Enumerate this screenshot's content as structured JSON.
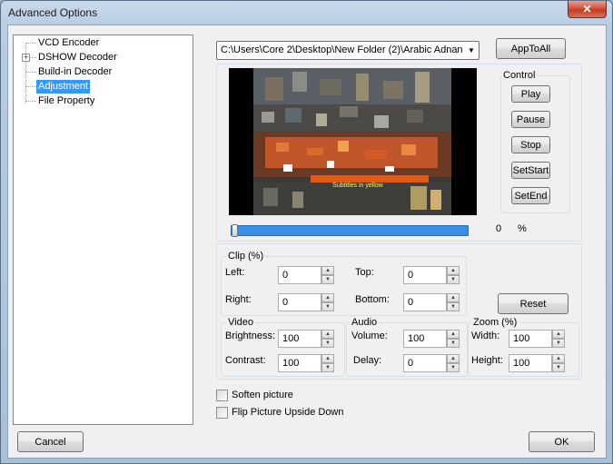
{
  "window": {
    "title": "Advanced Options",
    "close_glyph": "✕"
  },
  "tree": {
    "items": [
      {
        "label": "VCD Encoder",
        "has_children": false,
        "selected": false
      },
      {
        "label": "DSHOW Decoder",
        "has_children": true,
        "selected": false
      },
      {
        "label": "Build-in Decoder",
        "has_children": false,
        "selected": false
      },
      {
        "label": "Adjustment",
        "has_children": false,
        "selected": true
      },
      {
        "label": "File Property",
        "has_children": false,
        "selected": false
      }
    ],
    "expander_glyph": "+"
  },
  "file_combo": {
    "value": "C:\\Users\\Core 2\\Desktop\\New Folder (2)\\Arabic Adnan",
    "arrow_glyph": "▼"
  },
  "app_to_all_label": "AppToAll",
  "control": {
    "title": "Control",
    "play": "Play",
    "pause": "Pause",
    "stop": "Stop",
    "set_start": "SetStart",
    "set_end": "SetEnd"
  },
  "seek": {
    "position_fraction": 0.0,
    "position_value": "0",
    "unit": "%"
  },
  "clip": {
    "title": "Clip (%)",
    "left_label": "Left:",
    "left_value": "0",
    "top_label": "Top:",
    "top_value": "0",
    "right_label": "Right:",
    "right_value": "0",
    "bottom_label": "Bottom:",
    "bottom_value": "0"
  },
  "reset_label": "Reset",
  "video": {
    "title": "Video",
    "brightness_label": "Brightness:",
    "brightness_value": "100",
    "contrast_label": "Contrast:",
    "contrast_value": "100"
  },
  "audio": {
    "title": "Audio",
    "volume_label": "Volume:",
    "volume_value": "100",
    "delay_label": "Delay:",
    "delay_value": "0"
  },
  "zoom": {
    "title": "Zoom (%)",
    "width_label": "Width:",
    "width_value": "100",
    "height_label": "Height:",
    "height_value": "100"
  },
  "options": {
    "soften_label": "Soften picture",
    "soften_checked": false,
    "flip_label": "Flip Picture Upside Down",
    "flip_checked": false
  },
  "footer": {
    "cancel_label": "Cancel",
    "ok_label": "OK"
  },
  "preview": {
    "overlay_text": "Subtitles in yellow"
  },
  "colors": {
    "selection": "#3399ff",
    "seek_fill": "#3a8ee6",
    "close_red": "#c23a22"
  }
}
